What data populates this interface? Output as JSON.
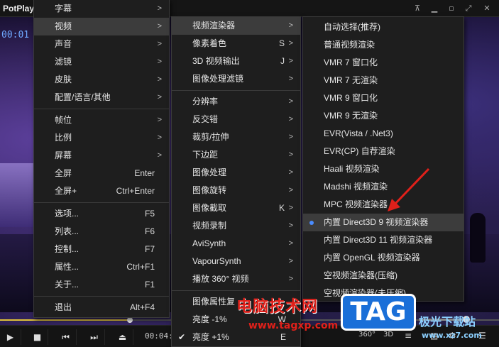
{
  "app": {
    "title": "PotPlaye"
  },
  "titlebar": {
    "pin_icon": "pin-icon",
    "buttons": [
      "minimize",
      "maximize",
      "close"
    ]
  },
  "video": {
    "timecode": "00:01"
  },
  "main_menu": {
    "items": [
      {
        "label": "字幕",
        "shortcut": "",
        "submenu": true
      },
      {
        "label": "视频",
        "shortcut": "",
        "submenu": true,
        "highlighted": true
      },
      {
        "label": "声音",
        "shortcut": "",
        "submenu": true
      },
      {
        "label": "滤镜",
        "shortcut": "",
        "submenu": true
      },
      {
        "label": "皮肤",
        "shortcut": "",
        "submenu": true
      },
      {
        "label": "配置/语言/其他",
        "shortcut": "",
        "submenu": true
      },
      {
        "sep": true
      },
      {
        "label": "帧位",
        "shortcut": "",
        "submenu": true
      },
      {
        "label": "比例",
        "shortcut": "",
        "submenu": true
      },
      {
        "label": "屏幕",
        "shortcut": "",
        "submenu": true
      },
      {
        "label": "全屏",
        "shortcut": "Enter",
        "submenu": false
      },
      {
        "label": "全屏+",
        "shortcut": "Ctrl+Enter",
        "submenu": false
      },
      {
        "sep": true
      },
      {
        "label": "选项...",
        "shortcut": "F5",
        "submenu": false
      },
      {
        "label": "列表...",
        "shortcut": "F6",
        "submenu": false
      },
      {
        "label": "控制...",
        "shortcut": "F7",
        "submenu": false
      },
      {
        "label": "属性...",
        "shortcut": "Ctrl+F1",
        "submenu": false
      },
      {
        "label": "关于...",
        "shortcut": "F1",
        "submenu": false
      },
      {
        "sep": true
      },
      {
        "label": "退出",
        "shortcut": "Alt+F4",
        "submenu": false
      }
    ]
  },
  "video_menu": {
    "items": [
      {
        "label": "视频渲染器",
        "shortcut": "",
        "submenu": true,
        "highlighted": true
      },
      {
        "label": "像素着色",
        "shortcut": "S",
        "submenu": true
      },
      {
        "label": "3D 视频输出",
        "shortcut": "J",
        "submenu": true
      },
      {
        "label": "图像处理滤镜",
        "shortcut": "",
        "submenu": true
      },
      {
        "sep": true
      },
      {
        "label": "分辨率",
        "shortcut": "",
        "submenu": true
      },
      {
        "label": "反交错",
        "shortcut": "",
        "submenu": true
      },
      {
        "label": "裁剪/拉伸",
        "shortcut": "",
        "submenu": true
      },
      {
        "label": "下边距",
        "shortcut": "",
        "submenu": true
      },
      {
        "label": "图像处理",
        "shortcut": "",
        "submenu": true
      },
      {
        "label": "图像旋转",
        "shortcut": "",
        "submenu": true
      },
      {
        "label": "图像截取",
        "shortcut": "K",
        "submenu": true
      },
      {
        "label": "视频录制",
        "shortcut": "",
        "submenu": true
      },
      {
        "label": "AviSynth",
        "shortcut": "",
        "submenu": true
      },
      {
        "label": "VapourSynth",
        "shortcut": "",
        "submenu": true
      },
      {
        "label": "播放 360° 视频",
        "shortcut": "",
        "submenu": true
      },
      {
        "sep": true
      },
      {
        "label": "图像属性复",
        "shortcut": "",
        "submenu": false
      },
      {
        "label": "亮度 -1%",
        "shortcut": "W",
        "submenu": false
      },
      {
        "label": "亮度 +1%",
        "shortcut": "E",
        "submenu": false,
        "checked": true
      }
    ]
  },
  "renderer_menu": {
    "items": [
      {
        "label": "自动选择(推荐)"
      },
      {
        "label": "普通视频渲染"
      },
      {
        "label": "VMR 7 窗口化"
      },
      {
        "label": "VMR 7 无渲染"
      },
      {
        "label": "VMR 9 窗口化"
      },
      {
        "label": "VMR 9 无渲染"
      },
      {
        "label": "EVR(Vista / .Net3)"
      },
      {
        "label": "EVR(CP) 自荐渲染"
      },
      {
        "label": "Haali 视频渲染"
      },
      {
        "label": "Madshi 视频渲染"
      },
      {
        "label": "MPC 视频渲染器"
      },
      {
        "label": "内置 Direct3D 9 视频渲染器",
        "selected": true,
        "highlighted": true
      },
      {
        "label": "内置 Direct3D 11 视频渲染器"
      },
      {
        "label": "内置 OpenGL 视频渲染器"
      },
      {
        "label": "空视频渲染器(压缩)"
      },
      {
        "label": "空视频渲染器(未压缩)"
      }
    ]
  },
  "controlbar": {
    "time": "00:04:",
    "seek_fraction": 0.26,
    "right_labels": [
      "360°",
      "3D"
    ]
  },
  "watermark": {
    "line1": "电脑技术网",
    "line2": "www.tagxp.com",
    "tag": "TAG",
    "line3": "极光下载站",
    "line4": "www.xz7.com"
  },
  "colors": {
    "accent": "#4a8cff",
    "highlight": "#3c3c3c",
    "menu_bg": "#1e1e1e",
    "arrow": "#e0201a"
  }
}
